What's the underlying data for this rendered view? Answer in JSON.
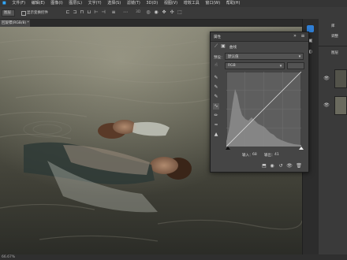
{
  "menu": [
    "文件(F)",
    "编辑(E)",
    "图像(I)",
    "图层(L)",
    "文字(Y)",
    "选择(S)",
    "滤镜(T)",
    "3D(D)",
    "视图(V)",
    "增效工具",
    "窗口(W)",
    "帮助(H)"
  ],
  "options": {
    "tool_dropdown": "图层",
    "show_transform_label": "显示变换控件"
  },
  "document": {
    "tab_label": "回旋镖(RGB/8) *",
    "status_zoom": "66.67%"
  },
  "properties": {
    "panel_title": "属性",
    "layer_type": "曲线",
    "preset_label": "预设：",
    "preset_value": "默认值",
    "channel_value": "RGB",
    "auto_button": "自动",
    "input_label": "输入：",
    "input_value": "68",
    "output_label": "输出：",
    "output_value": "41"
  },
  "dock": {
    "libraries_label": "库",
    "adjustments_label": "调整",
    "layers_label": "图层"
  },
  "colors": {
    "accent": "#2f7fd6",
    "panel_bg": "#454545",
    "histogram": "#8a8a8a"
  }
}
